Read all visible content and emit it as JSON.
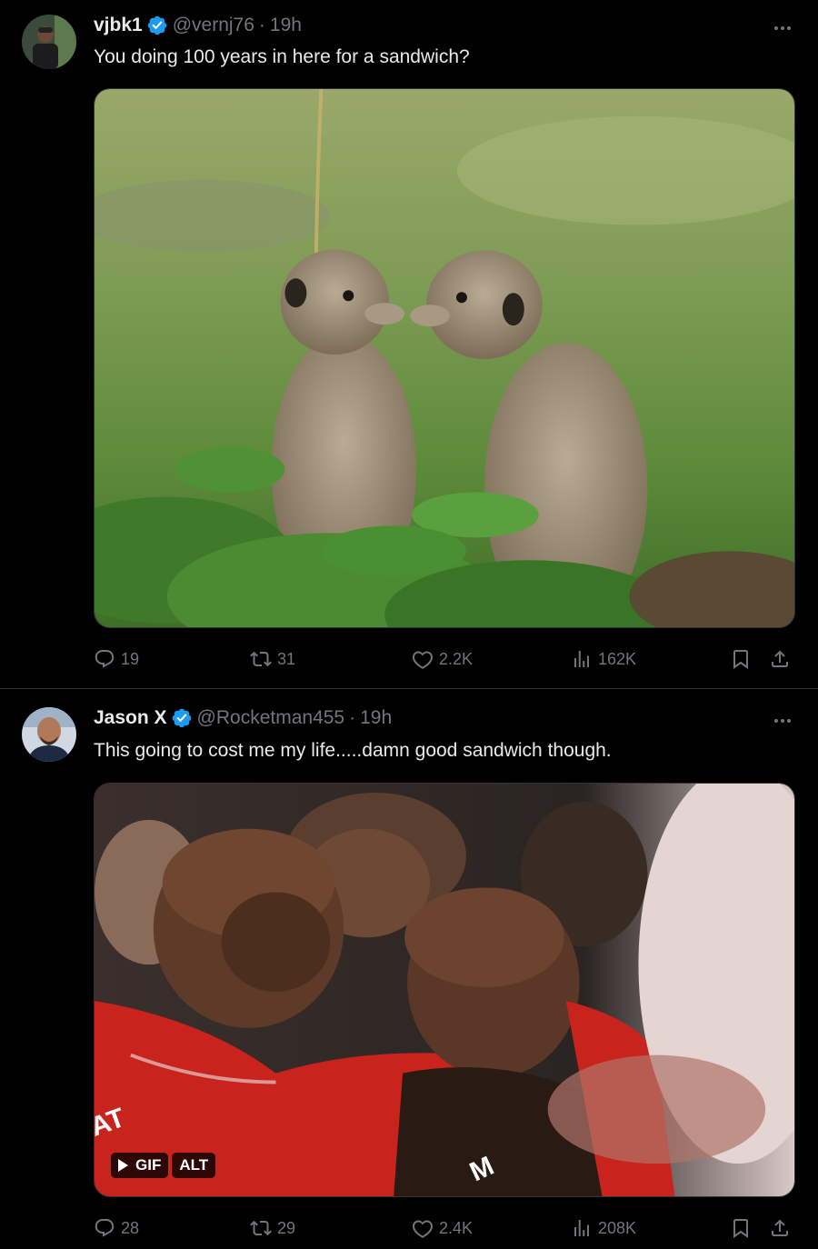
{
  "tweets": [
    {
      "name": "vjbk1",
      "handle": "@vernj76",
      "separator": "·",
      "time": "19h",
      "text": "You doing 100 years in here for a sandwich?",
      "media": {
        "type": "photo",
        "icon": "meerkats-photo"
      },
      "stats": {
        "replies": "19",
        "reposts": "31",
        "likes": "2.2K",
        "views": "162K"
      }
    },
    {
      "name": "Jason X",
      "handle": "@Rocketman455",
      "separator": "·",
      "time": "19h",
      "text": "This going to cost me my life.....damn good sandwich though.",
      "media": {
        "type": "gif",
        "icon": "basketball-bench-gif",
        "gif_label": "GIF",
        "alt_label": "ALT"
      },
      "stats": {
        "replies": "28",
        "reposts": "29",
        "likes": "2.4K",
        "views": "208K"
      }
    }
  ],
  "colors": {
    "background": "#000000",
    "text": "#e7e9ea",
    "muted": "#71767b",
    "verified": "#1d9bf0",
    "divider": "#2f3336"
  }
}
